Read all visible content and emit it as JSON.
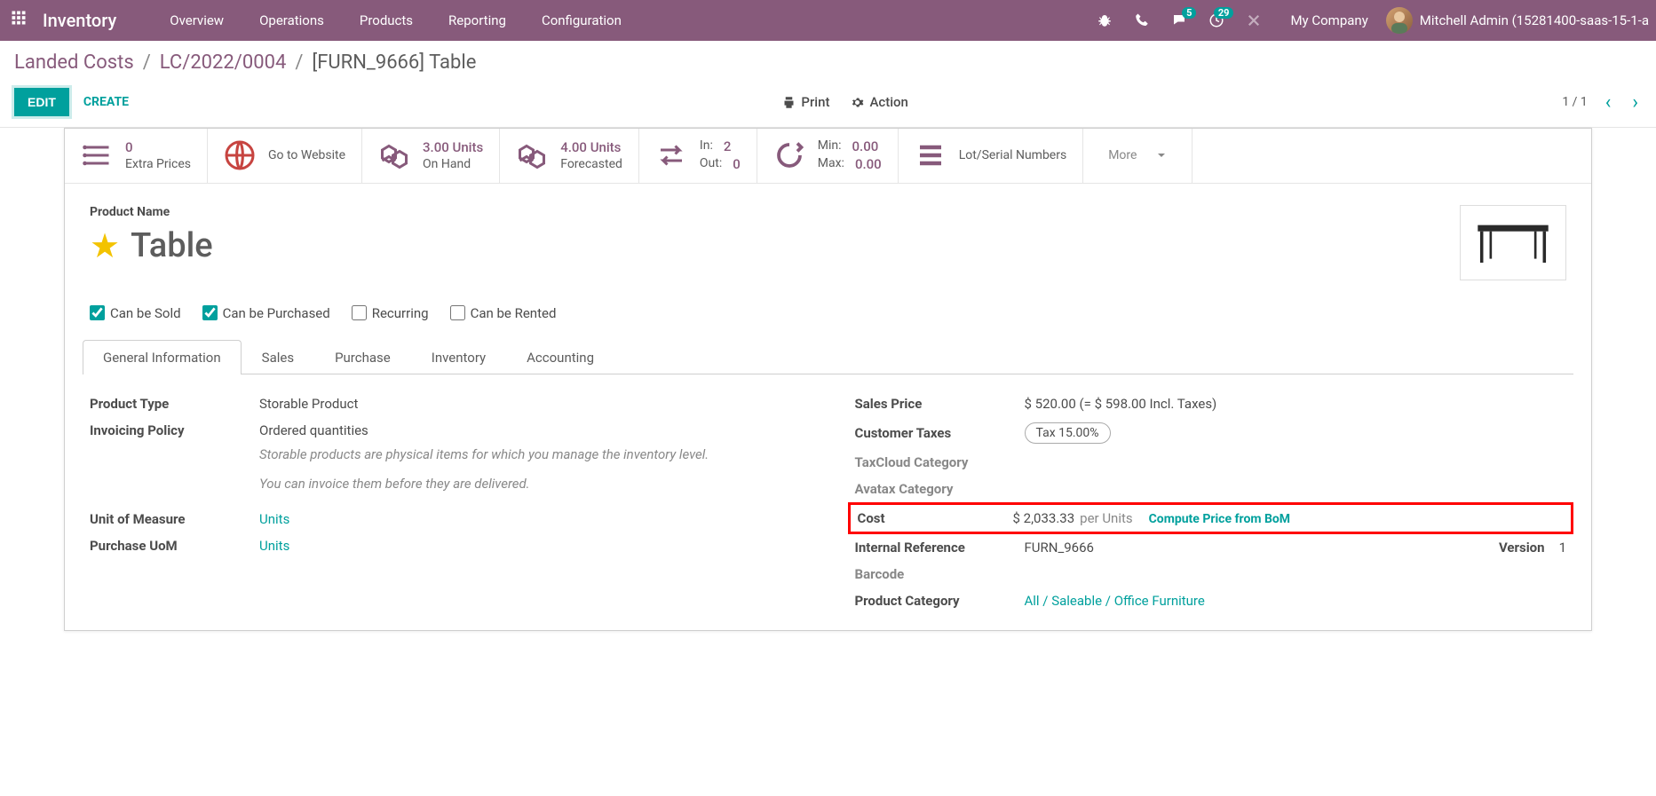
{
  "navbar": {
    "app": "Inventory",
    "menus": [
      "Overview",
      "Operations",
      "Products",
      "Reporting",
      "Configuration"
    ],
    "msg_badge": "5",
    "act_badge": "29",
    "company": "My Company",
    "user": "Mitchell Admin (15281400-saas-15-1-a"
  },
  "breadcrumb": {
    "a": "Landed Costs",
    "b": "LC/2022/0004",
    "c": "[FURN_9666] Table"
  },
  "controls": {
    "edit": "EDIT",
    "create": "CREATE",
    "print": "Print",
    "action": "Action",
    "pager": "1 / 1"
  },
  "stats": {
    "extra_n": "0",
    "extra_t": "Extra Prices",
    "website": "Go to Website",
    "onhand_n": "3.00 Units",
    "onhand_t": "On Hand",
    "forecast_n": "4.00 Units",
    "forecast_t": "Forecasted",
    "in_l": "In:",
    "in_v": "2",
    "out_l": "Out:",
    "out_v": "0",
    "min_l": "Min:",
    "min_v": "0.00",
    "max_l": "Max:",
    "max_v": "0.00",
    "lot": "Lot/Serial Numbers",
    "more": "More"
  },
  "product": {
    "name_label": "Product Name",
    "name": "Table"
  },
  "checks": {
    "sold": "Can be Sold",
    "purchased": "Can be Purchased",
    "recurring": "Recurring",
    "rented": "Can be Rented"
  },
  "tabs": [
    "General Information",
    "Sales",
    "Purchase",
    "Inventory",
    "Accounting"
  ],
  "fields": {
    "product_type_l": "Product Type",
    "product_type_v": "Storable Product",
    "inv_policy_l": "Invoicing Policy",
    "inv_policy_v": "Ordered quantities",
    "hint1": "Storable products are physical items for which you manage the inventory level.",
    "hint2": "You can invoice them before they are delivered.",
    "uom_l": "Unit of Measure",
    "uom_v": "Units",
    "puom_l": "Purchase UoM",
    "puom_v": "Units",
    "sales_price_l": "Sales Price",
    "sales_price_v": "$ 520.00  (= $ 598.00 Incl. Taxes)",
    "ctax_l": "Customer Taxes",
    "ctax_v": "Tax 15.00%",
    "taxcloud_l": "TaxCloud Category",
    "avatax_l": "Avatax Category",
    "cost_l": "Cost",
    "cost_v": "$ 2,033.33",
    "cost_unit": "per Units",
    "compute": "Compute Price from BoM",
    "iref_l": "Internal Reference",
    "iref_v": "FURN_9666",
    "version_l": "Version",
    "version_v": "1",
    "barcode_l": "Barcode",
    "pcat_l": "Product Category",
    "pcat_v": "All / Saleable / Office Furniture"
  }
}
